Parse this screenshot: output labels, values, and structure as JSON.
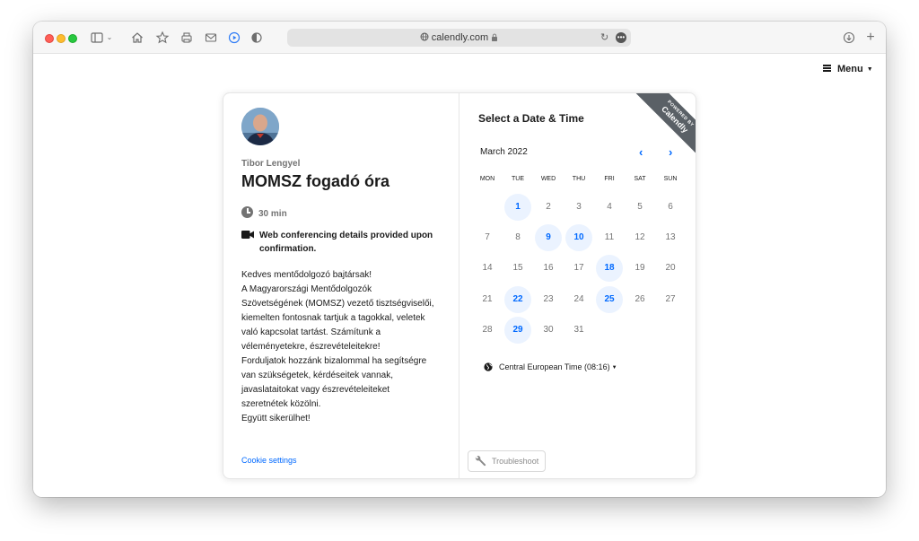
{
  "browser": {
    "url": "calendly.com",
    "download_icon": "arrow-down-circle-icon",
    "new_tab_icon": "plus-icon"
  },
  "page": {
    "menu_label": "Menu"
  },
  "event": {
    "host_name": "Tibor Lengyel",
    "title": "MOMSZ fogadó óra",
    "duration": "30 min",
    "conferencing": "Web conferencing details provided upon confirmation.",
    "description_lines": [
      "Kedves mentődolgozó bajtársak!",
      "A Magyarországi Mentődolgozók",
      "Szövetségének (MOMSZ) vezető tisztségviselői,",
      "kiemelten fontosnak tartjuk a tagokkal, veletek",
      "való kapcsolat tartást. Számítunk a",
      "véleményetekre, észrevételeitekre!",
      "Forduljatok hozzánk bizalommal ha segítségre",
      "van szükségetek, kérdéseitek vannak,",
      "javaslataitokat vagy észrevételeiteket",
      "szeretnétek közölni.",
      "Együtt sikerülhet!"
    ],
    "cookie_settings": "Cookie settings"
  },
  "calendar": {
    "heading": "Select a Date & Time",
    "ribbon_small": "POWERED BY",
    "ribbon_brand": "Calendly",
    "month": "March 2022",
    "prev_icon": "chevron-left-icon",
    "next_icon": "chevron-right-icon",
    "weekdays": [
      "MON",
      "TUE",
      "WED",
      "THU",
      "FRI",
      "SAT",
      "SUN"
    ],
    "first_weekday_index": 1,
    "days_in_month": 31,
    "available_days": [
      1,
      9,
      10,
      18,
      22,
      25,
      29
    ],
    "timezone": "Central European Time (08:16)",
    "troubleshoot": "Troubleshoot"
  }
}
